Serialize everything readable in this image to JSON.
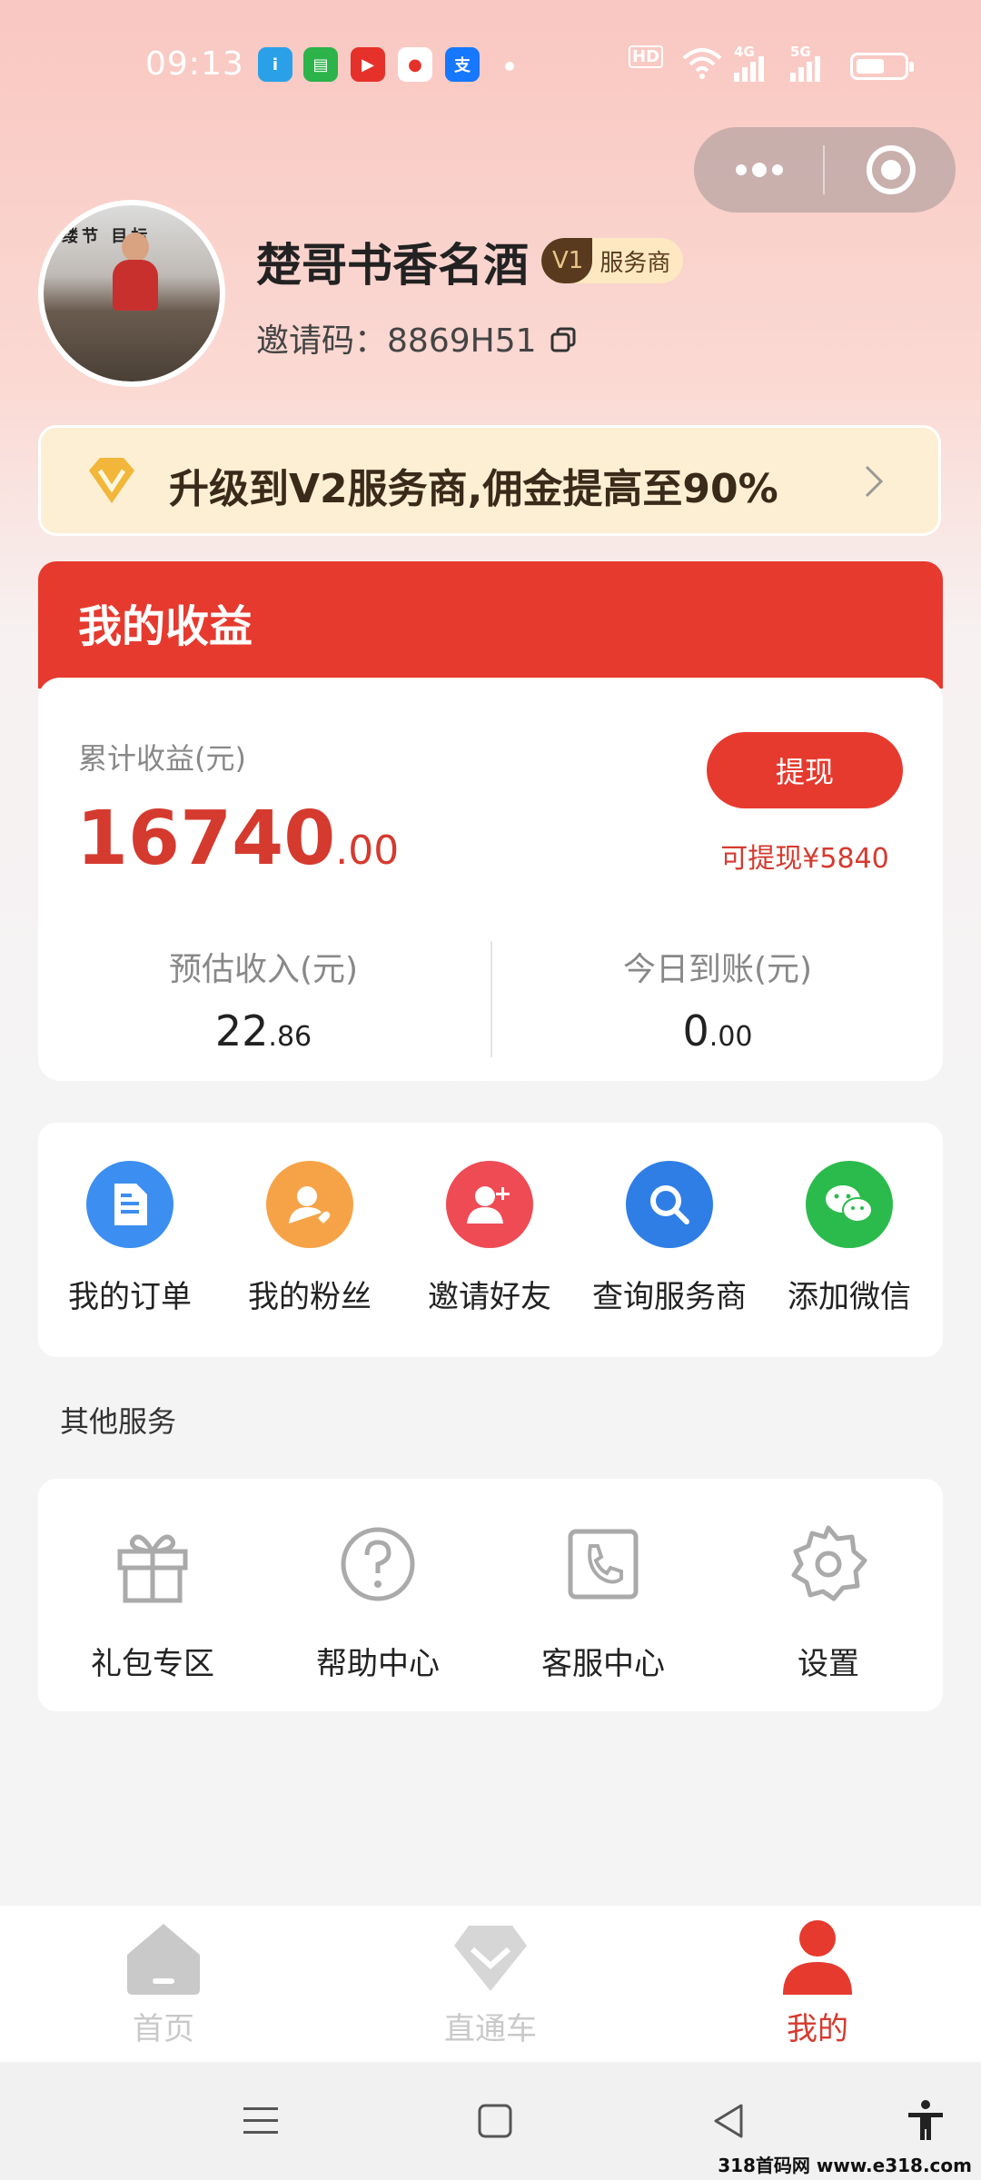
{
  "status_bar": {
    "time": "09:13",
    "apps": [
      {
        "icon": "app-icon-blue-chat",
        "color": "#2aa0e8",
        "glyph": "i"
      },
      {
        "icon": "app-icon-green-msg",
        "color": "#2cb34a",
        "glyph": "▤"
      },
      {
        "icon": "app-icon-red-video",
        "color": "#e5312a",
        "glyph": "▶"
      },
      {
        "icon": "app-icon-map-pin",
        "color": "#ffffff",
        "glyph": "●"
      },
      {
        "icon": "alipay-icon",
        "color": "#1677ff",
        "glyph": "支"
      }
    ],
    "hd": "HD",
    "net1": "4G",
    "net2": "5G"
  },
  "profile": {
    "name": "楚哥书香名酒",
    "level": "V1",
    "role": "服务商",
    "invite_label": "邀请码：",
    "invite_code": "8869H51"
  },
  "upgrade_banner": {
    "text": "升级到V2服务商,佣金提高至90%"
  },
  "earnings": {
    "title": "我的收益",
    "total_label": "累计收益(元)",
    "total_int": "16740",
    "total_dec": ".00",
    "withdraw_label": "提现",
    "withdrawable": "可提现¥5840",
    "estimated_label": "预估收入(元)",
    "estimated_int": "22",
    "estimated_dec": ".86",
    "today_label": "今日到账(元)",
    "today_int": "0",
    "today_dec": ".00"
  },
  "quick_actions": [
    {
      "label": "我的订单",
      "icon": "document-icon",
      "color": "#3c8ef0"
    },
    {
      "label": "我的粉丝",
      "icon": "fans-icon",
      "color": "#f6a348"
    },
    {
      "label": "邀请好友",
      "icon": "add-user-icon",
      "color": "#ee4b55"
    },
    {
      "label": "查询服务商",
      "icon": "search-icon",
      "color": "#2f7ee6"
    },
    {
      "label": "添加微信",
      "icon": "wechat-icon",
      "color": "#2bbb4c"
    }
  ],
  "other_services": {
    "title": "其他服务",
    "items": [
      {
        "label": "礼包专区",
        "icon": "gift-icon"
      },
      {
        "label": "帮助中心",
        "icon": "help-icon"
      },
      {
        "label": "客服中心",
        "icon": "phone-icon"
      },
      {
        "label": "设置",
        "icon": "gear-icon"
      }
    ]
  },
  "bottom_nav": [
    {
      "label": "首页",
      "icon": "home-icon",
      "active": false
    },
    {
      "label": "直通车",
      "icon": "diamond-icon",
      "active": false
    },
    {
      "label": "我的",
      "icon": "profile-icon",
      "active": true
    }
  ],
  "watermark": "318首码网 www.e318.com"
}
